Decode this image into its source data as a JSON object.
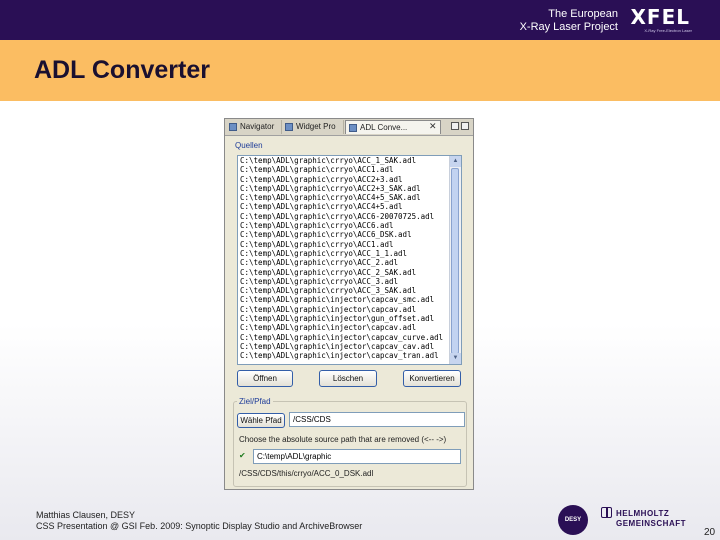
{
  "header": {
    "org_line1": "The European",
    "org_line2": "X-Ray Laser Project",
    "logo": "XFEL",
    "logo_sub": "X-Ray Free-Electron Laser"
  },
  "slide": {
    "title": "ADL Converter"
  },
  "window": {
    "tabs": [
      {
        "label": "Navigator",
        "icon": "navigator-icon"
      },
      {
        "label": "Widget Pro",
        "icon": "widget-icon"
      },
      {
        "label": "ADL Conve...",
        "icon": "adl-converter-icon"
      }
    ],
    "files_group_label": "Quellen",
    "files": [
      "C:\\temp\\ADL\\graphic\\crryo\\ACC_1_SAK.adl",
      "C:\\temp\\ADL\\graphic\\crryo\\ACC1.adl",
      "C:\\temp\\ADL\\graphic\\crryo\\ACC2+3.adl",
      "C:\\temp\\ADL\\graphic\\crryo\\ACC2+3_SAK.adl",
      "C:\\temp\\ADL\\graphic\\crryo\\ACC4+5_SAK.adl",
      "C:\\temp\\ADL\\graphic\\crryo\\ACC4+5.adl",
      "C:\\temp\\ADL\\graphic\\crryo\\ACC6-20070725.adl",
      "C:\\temp\\ADL\\graphic\\crryo\\ACC6.adl",
      "C:\\temp\\ADL\\graphic\\crryo\\ACC6_DSK.adl",
      "C:\\temp\\ADL\\graphic\\crryo\\ACC1.adl",
      "C:\\temp\\ADL\\graphic\\crryo\\ACC_1_1.adl",
      "C:\\temp\\ADL\\graphic\\crryo\\ACC_2.adl",
      "C:\\temp\\ADL\\graphic\\crryo\\ACC_2_SAK.adl",
      "C:\\temp\\ADL\\graphic\\crryo\\ACC_3.adl",
      "C:\\temp\\ADL\\graphic\\crryo\\ACC_3_SAK.adl",
      "C:\\temp\\ADL\\graphic\\injector\\capcav_smc.adl",
      "C:\\temp\\ADL\\graphic\\injector\\capcav.adl",
      "C:\\temp\\ADL\\graphic\\injector\\gun_offset.adl",
      "C:\\temp\\ADL\\graphic\\injector\\capcav.adl",
      "C:\\temp\\ADL\\graphic\\injector\\capcav_curve.adl",
      "C:\\temp\\ADL\\graphic\\injector\\capcav_cav.adl",
      "C:\\temp\\ADL\\graphic\\injector\\capcav_tran.adl"
    ],
    "buttons": {
      "open": "Öffnen",
      "delete": "Löschen",
      "convert": "Konvertieren"
    },
    "target_group_label": "Ziel/Pfad",
    "choose_path_button": "Wähle Pfad",
    "target_path": "/CSS/CDS",
    "absolute_path_hint": "Choose the absolute source path that are removed (<-- ->)",
    "source_path": "C:\\temp\\ADL\\graphic",
    "result_preview": "/CSS/CDS/this/crryo/ACC_0_DSK.adl"
  },
  "footer": {
    "author": "Matthias Clausen, DESY",
    "event": "CSS Presentation @ GSI Feb. 2009: Synoptic Display Studio and ArchiveBrowser",
    "desy_logo": "DESY",
    "helmholtz_line1": "HELMHOLTZ",
    "helmholtz_line2": "GEMEINSCHAFT",
    "page_number": "20"
  }
}
